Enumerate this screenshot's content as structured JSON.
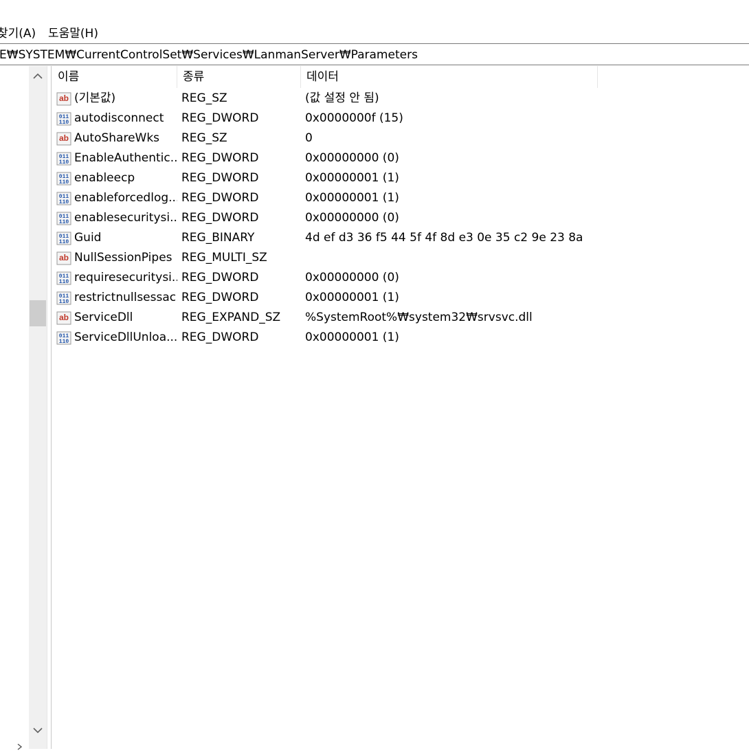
{
  "menu": {
    "find": "찾기(A)",
    "help": "도움말(H)"
  },
  "address": {
    "path": "IE₩SYSTEM₩CurrentControlSet₩Services₩LanmanServer₩Parameters"
  },
  "columns": {
    "name": "이름",
    "type": "종류",
    "data": "데이터"
  },
  "rows": [
    {
      "icon": "string-value-icon",
      "name": "(기본값)",
      "type": "REG_SZ",
      "data": "(값 설정 안 됨)"
    },
    {
      "icon": "binary-value-icon",
      "name": "autodisconnect",
      "type": "REG_DWORD",
      "data": "0x0000000f (15)"
    },
    {
      "icon": "string-value-icon",
      "name": "AutoShareWks",
      "type": "REG_SZ",
      "data": "0"
    },
    {
      "icon": "binary-value-icon",
      "name": "EnableAuthentic...",
      "type": "REG_DWORD",
      "data": "0x00000000 (0)"
    },
    {
      "icon": "binary-value-icon",
      "name": "enableecp",
      "type": "REG_DWORD",
      "data": "0x00000001 (1)"
    },
    {
      "icon": "binary-value-icon",
      "name": "enableforcedlog...",
      "type": "REG_DWORD",
      "data": "0x00000001 (1)"
    },
    {
      "icon": "binary-value-icon",
      "name": "enablesecuritysi...",
      "type": "REG_DWORD",
      "data": "0x00000000 (0)"
    },
    {
      "icon": "binary-value-icon",
      "name": "Guid",
      "type": "REG_BINARY",
      "data": "4d ef d3 36 f5 44 5f 4f 8d e3 0e 35 c2 9e 23 8a"
    },
    {
      "icon": "string-value-icon",
      "name": "NullSessionPipes",
      "type": "REG_MULTI_SZ",
      "data": ""
    },
    {
      "icon": "binary-value-icon",
      "name": "requiresecuritysi...",
      "type": "REG_DWORD",
      "data": "0x00000000 (0)"
    },
    {
      "icon": "binary-value-icon",
      "name": "restrictnullsessac...",
      "type": "REG_DWORD",
      "data": "0x00000001 (1)"
    },
    {
      "icon": "string-value-icon",
      "name": "ServiceDll",
      "type": "REG_EXPAND_SZ",
      "data": "%SystemRoot%₩system32₩srvsvc.dll"
    },
    {
      "icon": "binary-value-icon",
      "name": "ServiceDllUnloa...",
      "type": "REG_DWORD",
      "data": "0x00000001 (1)"
    }
  ],
  "colors": {
    "string_icon": "#c0392b",
    "binary_icon": "#2255aa",
    "scroll_thumb": "#cdcdcd"
  }
}
